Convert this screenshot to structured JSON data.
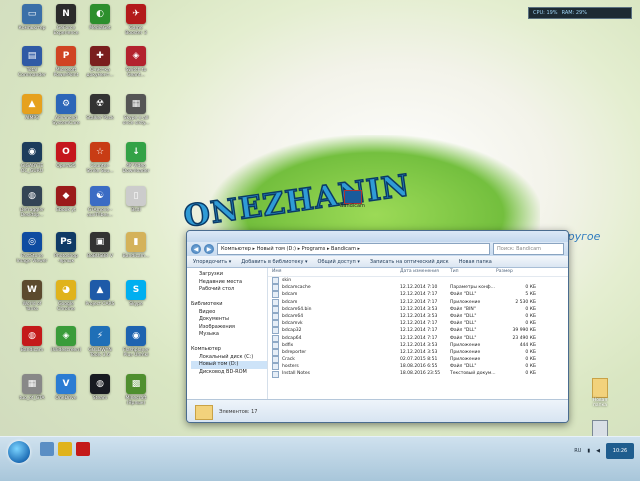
{
  "wallpaper": {
    "title": "ONEZHANIN",
    "subtitle": "другое",
    "bandicam_label": "Bandicam"
  },
  "meter": {
    "cpu": "CPU: 19%",
    "ram": "RAM: 29%"
  },
  "desktop_icons": [
    {
      "label": "Компьютер",
      "color": "#3a6fa8",
      "glyph": "▭"
    },
    {
      "label": "GeForce Experience",
      "color": "#2b2b2b",
      "glyph": "N"
    },
    {
      "label": "MediaGet",
      "color": "#2d8f2d",
      "glyph": "◐"
    },
    {
      "label": "Game Booster 3",
      "color": "#b31b1b",
      "glyph": "✈"
    },
    {
      "label": "Total Commander",
      "color": "#2f5aa5",
      "glyph": "▤"
    },
    {
      "label": "Microsoft PowerPoint",
      "color": "#d04423",
      "glyph": "P"
    },
    {
      "label": "Очистка документ...",
      "color": "#7a1e1e",
      "glyph": "✚"
    },
    {
      "label": "Switch to Geant...",
      "color": "#b3222e",
      "glyph": "◈"
    },
    {
      "label": "AIMP3",
      "color": "#e6a11e",
      "glyph": "▲"
    },
    {
      "label": "Advanced SystemCare",
      "color": "#2c66b8",
      "glyph": "⚙"
    },
    {
      "label": "Stalker Pack",
      "color": "#333",
      "glyph": "☢"
    },
    {
      "label": "Skype e-all once sixty...",
      "color": "#555",
      "glyph": "▦"
    },
    {
      "label": "GIGABYTE OC_GURU",
      "color": "#1c3c5c",
      "glyph": "◉"
    },
    {
      "label": "Opera25",
      "color": "#c5161d",
      "glyph": "O"
    },
    {
      "label": "Counter-Strike Sou...",
      "color": "#c83c15",
      "glyph": "☆"
    },
    {
      "label": "4K Video Downloader",
      "color": "#33a246",
      "glyph": "↓"
    },
    {
      "label": "Defraggler Desktop...",
      "color": "#345",
      "glyph": "◍"
    },
    {
      "label": "Ebook yt",
      "color": "#9b1b1b",
      "glyph": "◆"
    },
    {
      "label": "GTAmove - auxTribes...",
      "color": "#3b6cc4",
      "glyph": "☯"
    },
    {
      "label": "Bsdl",
      "color": "#ccc",
      "glyph": "▯"
    },
    {
      "label": "FastStone Image Viewer",
      "color": "#0e4ca1",
      "glyph": "◎"
    },
    {
      "label": "Photoshop -ярлык",
      "color": "#0f3a66",
      "glyph": "Ps"
    },
    {
      "label": "BoBUSBR V",
      "color": "#333",
      "glyph": "▣"
    },
    {
      "label": "Bandicam...",
      "color": "#d4b25a",
      "glyph": "▮"
    },
    {
      "label": "World of Tanks",
      "color": "#5c4a2e",
      "glyph": "W"
    },
    {
      "label": "Google Chrome",
      "color": "#e0b31c",
      "glyph": "◕"
    },
    {
      "label": "Project CARS",
      "color": "#1e5aa8",
      "glyph": "▲"
    },
    {
      "label": "Skype",
      "color": "#00aff0",
      "glyph": "S"
    },
    {
      "label": "Bandicam",
      "color": "#c41a1a",
      "glyph": "◍"
    },
    {
      "label": "[Widescreen]",
      "color": "#3a9c3a",
      "glyph": "◈"
    },
    {
      "label": "GOLDWYN Tools 3.6",
      "color": "#1f6fb7",
      "glyph": "⚡"
    },
    {
      "label": "Flashplayer Plus Uhmkl",
      "color": "#1e63b0",
      "glyph": "◉"
    },
    {
      "label": "tuo_of_GTA",
      "color": "#888",
      "glyph": "▦"
    },
    {
      "label": "OneDrive",
      "color": "#2b7cd3",
      "glyph": "V"
    },
    {
      "label": "Steam",
      "color": "#171a21",
      "glyph": "◍"
    },
    {
      "label": "Minecraft (Ярлык)",
      "color": "#4f8f2f",
      "glyph": "▩"
    }
  ],
  "explorer": {
    "breadcrumb": "Компьютер ▸ Новый том (D:) ▸ Programs ▸ Bandicam ▸",
    "search_placeholder": "Поиск: Bandicam",
    "toolbar": [
      "Упорядочить ▾",
      "Добавить в библиотеку ▾",
      "Общий доступ ▾",
      "Записать на оптический диск",
      "Новая папка"
    ],
    "nav": [
      {
        "label": "Загрузки",
        "sub": true
      },
      {
        "label": "Недавние места",
        "sub": true
      },
      {
        "label": "Рабочий стол",
        "sub": true
      },
      {
        "label": ""
      },
      {
        "label": "Библиотеки",
        "sub": false
      },
      {
        "label": "Видео",
        "sub": true
      },
      {
        "label": "Документы",
        "sub": true
      },
      {
        "label": "Изображения",
        "sub": true
      },
      {
        "label": "Музыка",
        "sub": true
      },
      {
        "label": ""
      },
      {
        "label": "Компьютер",
        "sub": false
      },
      {
        "label": "Локальный диск (C:)",
        "sub": true
      },
      {
        "label": "Новый том (D:)",
        "sub": true,
        "selected": true
      },
      {
        "label": "Дисковод BD-ROM",
        "sub": true
      }
    ],
    "columns": [
      "Имя",
      "Дата изменения",
      "Тип",
      "Размер"
    ],
    "files": [
      {
        "name": "skin",
        "date": "",
        "type": "",
        "size": ""
      },
      {
        "name": "bdcamcache",
        "date": "12.12.2014 7:10",
        "type": "Параметры конф...",
        "size": "0 КБ"
      },
      {
        "name": "bdcam",
        "date": "12.12.2014 7:17",
        "type": "Файл \"DLL\"",
        "size": "5 КБ"
      },
      {
        "name": "bdcam",
        "date": "12.12.2014 7:17",
        "type": "Приложение",
        "size": "2 530 КБ"
      },
      {
        "name": "bdcam64.bin",
        "date": "12.12.2014 3:53",
        "type": "Файл \"BIN\"",
        "size": "0 КБ"
      },
      {
        "name": "bdcam64",
        "date": "12.12.2014 3:53",
        "type": "Файл \"DLL\"",
        "size": "0 КБ"
      },
      {
        "name": "bdcamvk",
        "date": "12.12.2014 7:17",
        "type": "Файл \"DLL\"",
        "size": "0 КБ"
      },
      {
        "name": "bdcap32",
        "date": "12.12.2014 7:17",
        "type": "Файл \"DLL\"",
        "size": "39 990 КБ"
      },
      {
        "name": "bdcap64",
        "date": "12.12.2014 7:17",
        "type": "Файл \"DLL\"",
        "size": "23 490 КБ"
      },
      {
        "name": "bdfix",
        "date": "12.12.2014 3:53",
        "type": "Приложение",
        "size": "444 КБ"
      },
      {
        "name": "bdreporter",
        "date": "12.12.2014 3:53",
        "type": "Приложение",
        "size": "0 КБ"
      },
      {
        "name": "Crack",
        "date": "02.07.2015 8:51",
        "type": "Приложение",
        "size": "0 КБ"
      },
      {
        "name": "hosters",
        "date": "18.08.2016 6:55",
        "type": "Файл \"DLL\"",
        "size": "0 КБ"
      },
      {
        "name": "Install Notes",
        "date": "18.08.2016 23:55",
        "type": "Текстовый докум...",
        "size": "0 КБ"
      }
    ],
    "status": "Элементов: 17"
  },
  "right_icons": [
    {
      "label": "Новая папка"
    },
    {
      "label": "Корзина"
    }
  ],
  "taskbar": {
    "lang": "RU",
    "time": "10:26"
  }
}
